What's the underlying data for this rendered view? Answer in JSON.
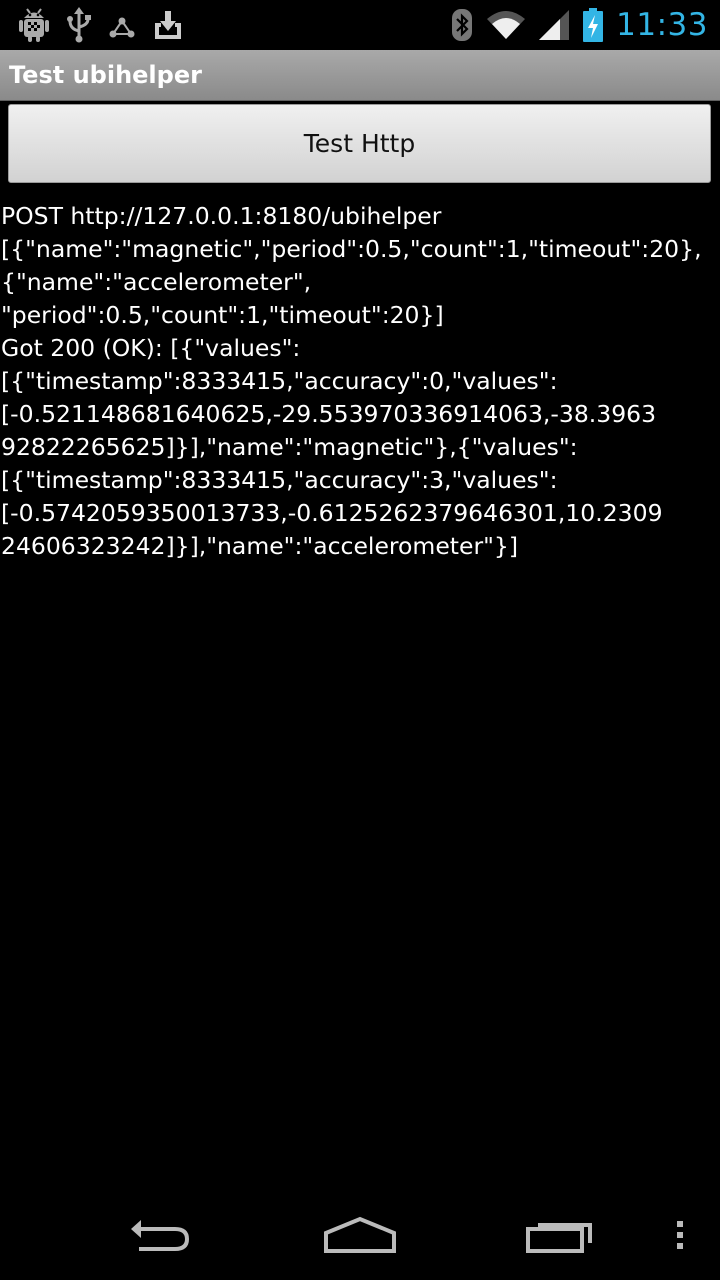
{
  "status_bar": {
    "time": "11:33",
    "left_icons": [
      "android-debug-icon",
      "usb-icon",
      "share-icon",
      "download-icon"
    ],
    "right_icons": [
      "bluetooth-icon",
      "wifi-icon",
      "cell-signal-icon",
      "battery-charging-icon"
    ],
    "accent_color": "#33b5e5"
  },
  "title_bar": {
    "title": "Test ubihelper"
  },
  "main": {
    "test_button_label": "Test Http",
    "output_text": "POST http://127.0.0.1:8180/ubihelper\n[{\"name\":\"magnetic\",\"period\":0.5,\"count\":1,\"timeout\":20},\n{\"name\":\"accelerometer\",\n\"period\":0.5,\"count\":1,\"timeout\":20}]\nGot 200 (OK): [{\"values\":\n[{\"timestamp\":8333415,\"accuracy\":0,\"values\":\n[-0.521148681640625,-29.553970336914063,-38.3963\n92822265625]}],\"name\":\"magnetic\"},{\"values\":\n[{\"timestamp\":8333415,\"accuracy\":3,\"values\":\n[-0.5742059350013733,-0.6125262379646301,10.2309\n24606323242]}],\"name\":\"accelerometer\"}]"
  },
  "nav_bar": {
    "buttons": [
      "back-icon",
      "home-icon",
      "recent-apps-icon",
      "overflow-menu-icon"
    ]
  }
}
